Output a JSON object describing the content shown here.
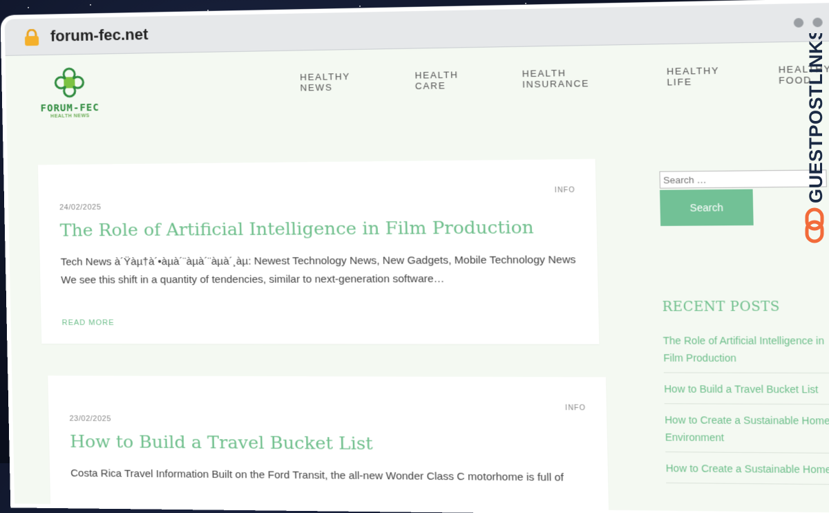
{
  "browser": {
    "url": "forum-fec.net"
  },
  "site": {
    "logo_name": "FORUM-FEC",
    "logo_tagline": "HEALTH NEWS"
  },
  "nav": {
    "items": [
      {
        "label": "HEALTHY NEWS"
      },
      {
        "label": "HEALTH CARE"
      },
      {
        "label": "HEALTH INSURANCE"
      },
      {
        "label": "HEALTHY LIFE"
      },
      {
        "label": "HEALTHY FOOD"
      }
    ]
  },
  "posts": [
    {
      "category": "INFO",
      "date": "24/02/2025",
      "title": "The Role of Artificial Intelligence in Film Production",
      "excerpt": "Tech News à´Ÿàµ†à´•àµà´¨àµà´¨àµà´¸àµ: Newest Technology News, New Gadgets, Mobile Technology News We see this shift in a quantity of tendencies, similar to next-generation software…",
      "read_more": "READ MORE"
    },
    {
      "category": "INFO",
      "date": "23/02/2025",
      "title": "How to Build a Travel Bucket List",
      "excerpt": "Costa Rica Travel Information Built on the Ford Transit, the all-new Wonder Class C motorhome is full of"
    }
  ],
  "sidebar": {
    "search_placeholder": "Search …",
    "search_button": "Search",
    "recent_title": "RECENT POSTS",
    "recent_posts": [
      {
        "label": "The Role of Artificial Intelligence in Film Production"
      },
      {
        "label": "How to Build a Travel Bucket List"
      },
      {
        "label": "How to Create a Sustainable Home Environment"
      },
      {
        "label": "How to Create a Sustainable Home"
      }
    ]
  },
  "watermark": {
    "text": "GUESTPOSTLINKS"
  },
  "colors": {
    "accent": "#72c196",
    "page_bg": "#f4f9f2",
    "logo_green": "#2e8b3e",
    "watermark_orange": "#f26b3a"
  }
}
